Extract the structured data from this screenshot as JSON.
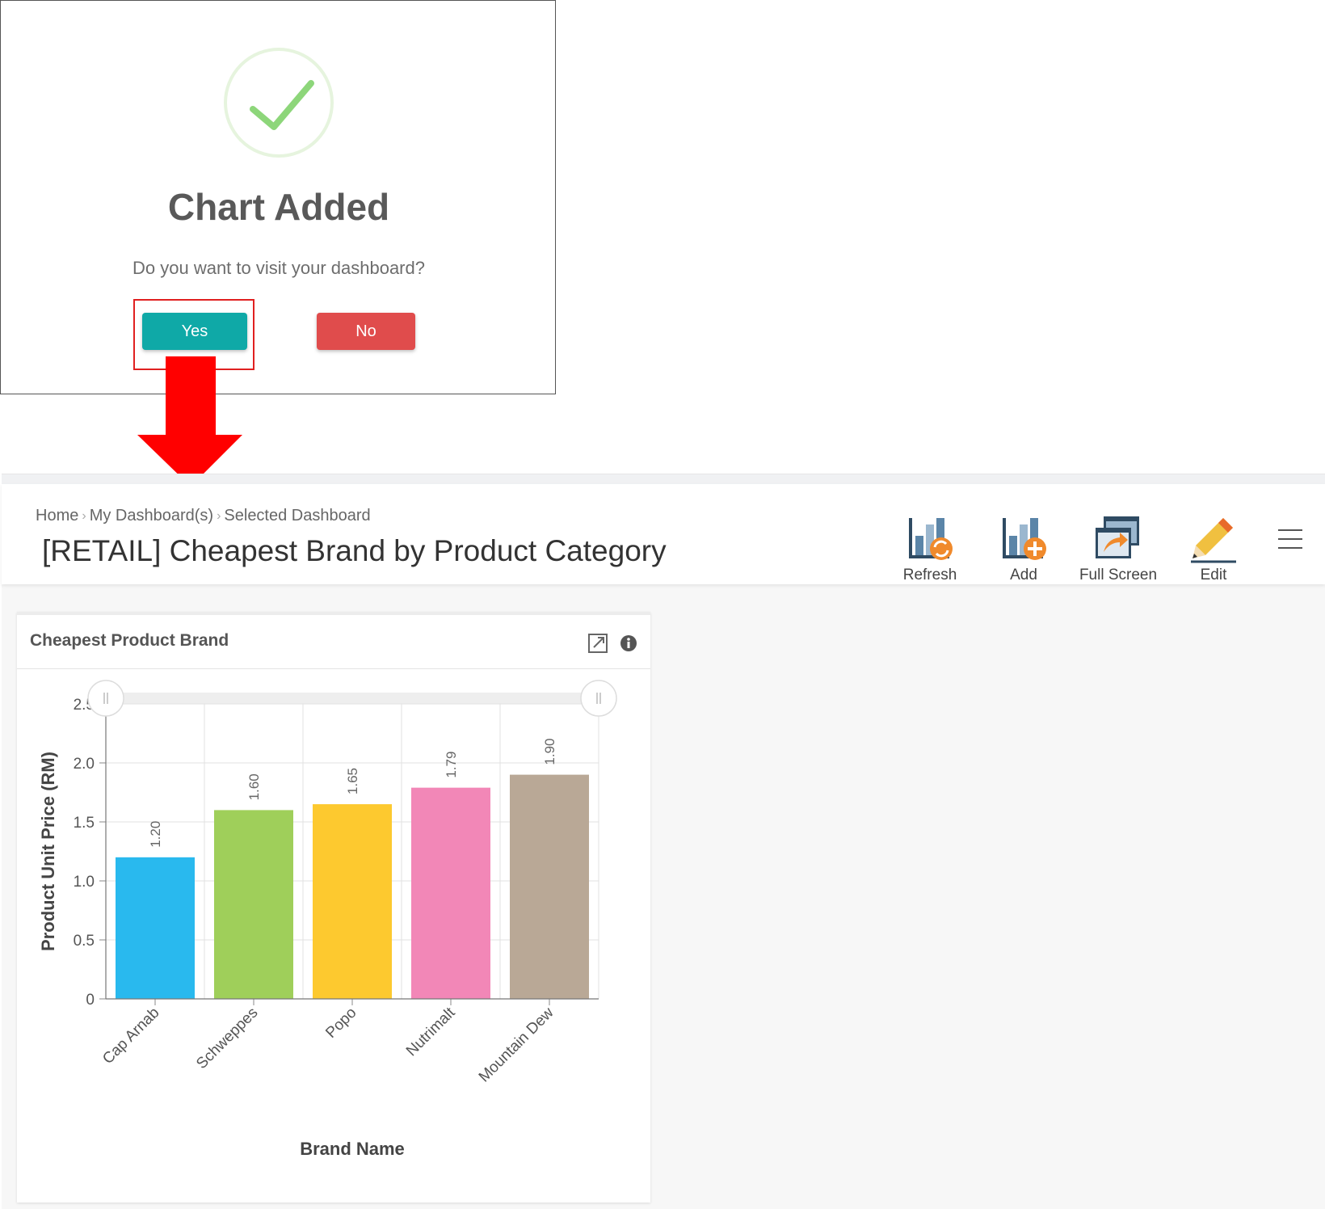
{
  "modal": {
    "title": "Chart Added",
    "message": "Do you want to visit your dashboard?",
    "yes_label": "Yes",
    "no_label": "No"
  },
  "breadcrumb": {
    "items": [
      "Home",
      "My Dashboard(s)",
      "Selected Dashboard"
    ]
  },
  "page_title": "[RETAIL] Cheapest Brand by Product Category",
  "toolbar": {
    "refresh_label": "Refresh",
    "add_label": "Add",
    "fullscreen_label": "Full Screen",
    "edit_label": "Edit"
  },
  "card": {
    "title": "Cheapest Product Brand"
  },
  "colors": {
    "yes": "#0fa9a7",
    "no": "#e04c4c",
    "highlight": "#e02020",
    "arrow": "#ff0000"
  },
  "chart_data": {
    "type": "bar",
    "categories": [
      "Cap Arnab",
      "Schweppes",
      "Popo",
      "Nutrimalt",
      "Mountain Dew"
    ],
    "values": [
      1.2,
      1.6,
      1.65,
      1.79,
      1.9
    ],
    "value_labels": [
      "1.20",
      "1.60",
      "1.65",
      "1.79",
      "1.90"
    ],
    "bar_colors": [
      "#29b9ee",
      "#9fcf5a",
      "#fdc92f",
      "#f287b7",
      "#b9a896"
    ],
    "xlabel": "Brand Name",
    "ylabel": "Product Unit Price (RM)",
    "ylim": [
      0,
      2.5
    ],
    "yticks": [
      "0",
      "0.5",
      "1.0",
      "1.5",
      "2.0",
      "2.5"
    ],
    "ytick_values": [
      0,
      0.5,
      1.0,
      1.5,
      2.0,
      2.5
    ],
    "grid": true
  }
}
